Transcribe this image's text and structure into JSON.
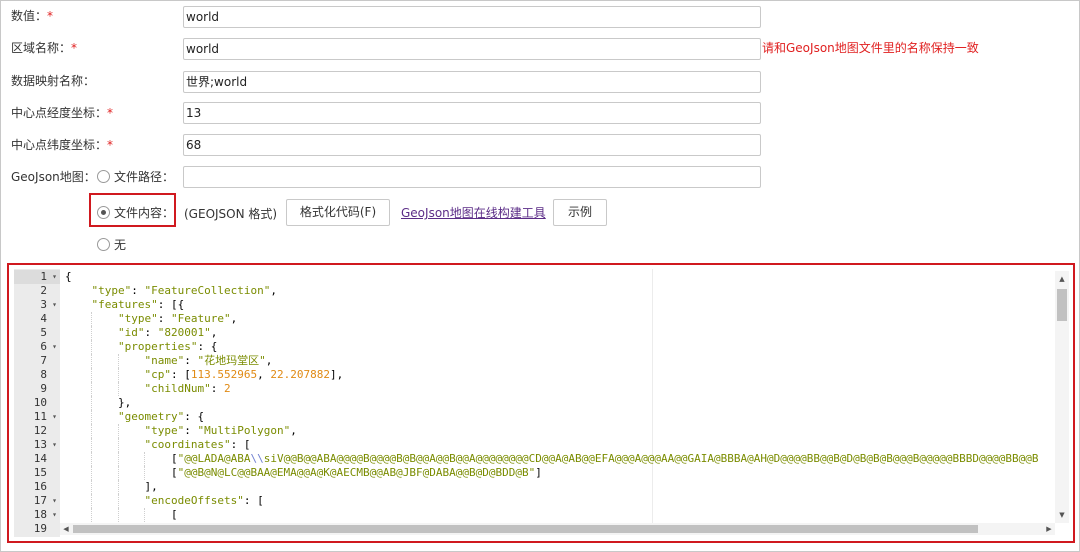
{
  "form": {
    "value_label": "数值：",
    "value_input": "world",
    "region_name_label": "区域名称：",
    "region_name_input": "world",
    "region_hint": "请和GeoJson地图文件里的名称保持一致",
    "mapping_label": "数据映射名称：",
    "mapping_input": "世界;world",
    "center_lng_label": "中心点经度坐标：",
    "center_lng_input": "13",
    "center_lat_label": "中心点纬度坐标：",
    "center_lat_input": "68",
    "required_mark": "*",
    "geojson_label": "GeoJson地图：",
    "option_file_path": "文件路径：",
    "file_path_value": "",
    "option_file_content": "文件内容：",
    "format_note": "(GEOJSON 格式)",
    "format_button": "格式化代码(F)",
    "builder_link": "GeoJson地图在线构建工具",
    "example_button": "示例",
    "option_none": "无",
    "selected_option": "文件内容："
  },
  "editor": {
    "line_numbers": [
      "1",
      "2",
      "3",
      "4",
      "5",
      "6",
      "7",
      "8",
      "9",
      "10",
      "11",
      "12",
      "13",
      "14",
      "15",
      "16",
      "17",
      "18",
      "19"
    ],
    "active_line": "1",
    "fold_lines": [
      "1",
      "3",
      "6",
      "11",
      "13",
      "17",
      "18"
    ],
    "code": [
      "{",
      "    \"type\": \"FeatureCollection\",",
      "    \"features\": [{",
      "        \"type\": \"Feature\",",
      "        \"id\": \"820001\",",
      "        \"properties\": {",
      "            \"name\": \"花地玛堂区\",",
      "            \"cp\": [113.552965, 22.207882],",
      "            \"childNum\": 2",
      "        },",
      "        \"geometry\": {",
      "            \"type\": \"MultiPolygon\",",
      "            \"coordinates\": [",
      "                [\"@@LADA@ABA\\\\siV@@B@@ABA@@@@B@@@@B@B@@A@@B@@A@@@@@@@@CD@@A@AB@@EFA@@@A@@@AA@@GAIA@BBBA@AH@D@@@@BB@@B@D@B@B@B@@@B@@@@@BBBD@@@@BB@@B",
      "                [\"@@B@N@LC@@BAA@EMA@@A@K@AECMB@@AB@JBF@DABA@@B@D@BDD@B\"]",
      "            ],",
      "            \"encodeOffsets\": [",
      "                [",
      ""
    ]
  }
}
